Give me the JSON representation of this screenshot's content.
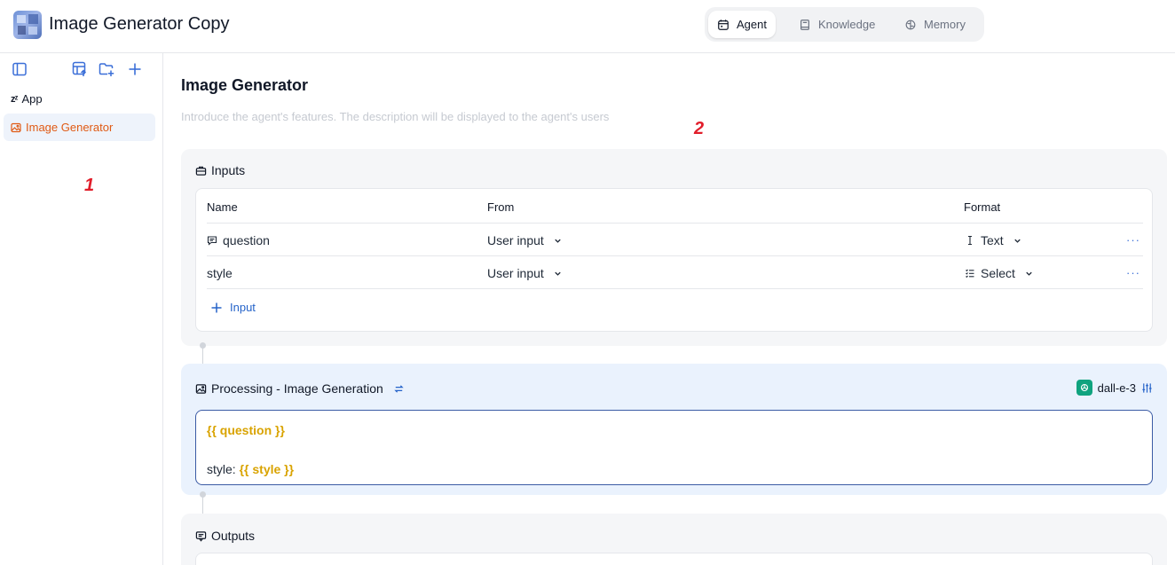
{
  "header": {
    "app_title": "Image Generator Copy",
    "tabs": [
      {
        "label": "Agent",
        "icon": "calendar-icon",
        "active": true
      },
      {
        "label": "Knowledge",
        "icon": "book-icon",
        "active": false
      },
      {
        "label": "Memory",
        "icon": "brain-icon",
        "active": false
      }
    ]
  },
  "sidebar": {
    "app_label": "App",
    "app_prefix": "zᶻ",
    "items": [
      {
        "label": "Image Generator",
        "icon": "image-icon",
        "selected": true
      }
    ]
  },
  "markers": {
    "one": "1",
    "two": "2"
  },
  "main": {
    "title": "Image Generator",
    "description_placeholder": "Introduce the agent's features. The description will be displayed to the agent's users",
    "inputs": {
      "heading": "Inputs",
      "columns": {
        "name": "Name",
        "from": "From",
        "format": "Format"
      },
      "rows": [
        {
          "name": "question",
          "name_icon": "message-icon",
          "from": "User input",
          "format": "Text",
          "format_icon": "text-cursor-icon",
          "more": "···"
        },
        {
          "name": "style",
          "from": "User input",
          "format": "Select",
          "format_icon": "list-icon",
          "more": "···"
        }
      ],
      "add_label": "Input"
    },
    "processing": {
      "heading": "Processing - Image Generation",
      "model": "dall-e-3",
      "prompt": {
        "line1_var": "{{ question }}",
        "line2_prefix": "style: ",
        "line2_var": "{{ style }}"
      }
    },
    "outputs": {
      "heading": "Outputs"
    }
  },
  "colors": {
    "accent_orange": "#e05a14",
    "link_blue": "#2563c9",
    "variable_gold": "#d9a300",
    "marker_red": "#e11d2a"
  }
}
